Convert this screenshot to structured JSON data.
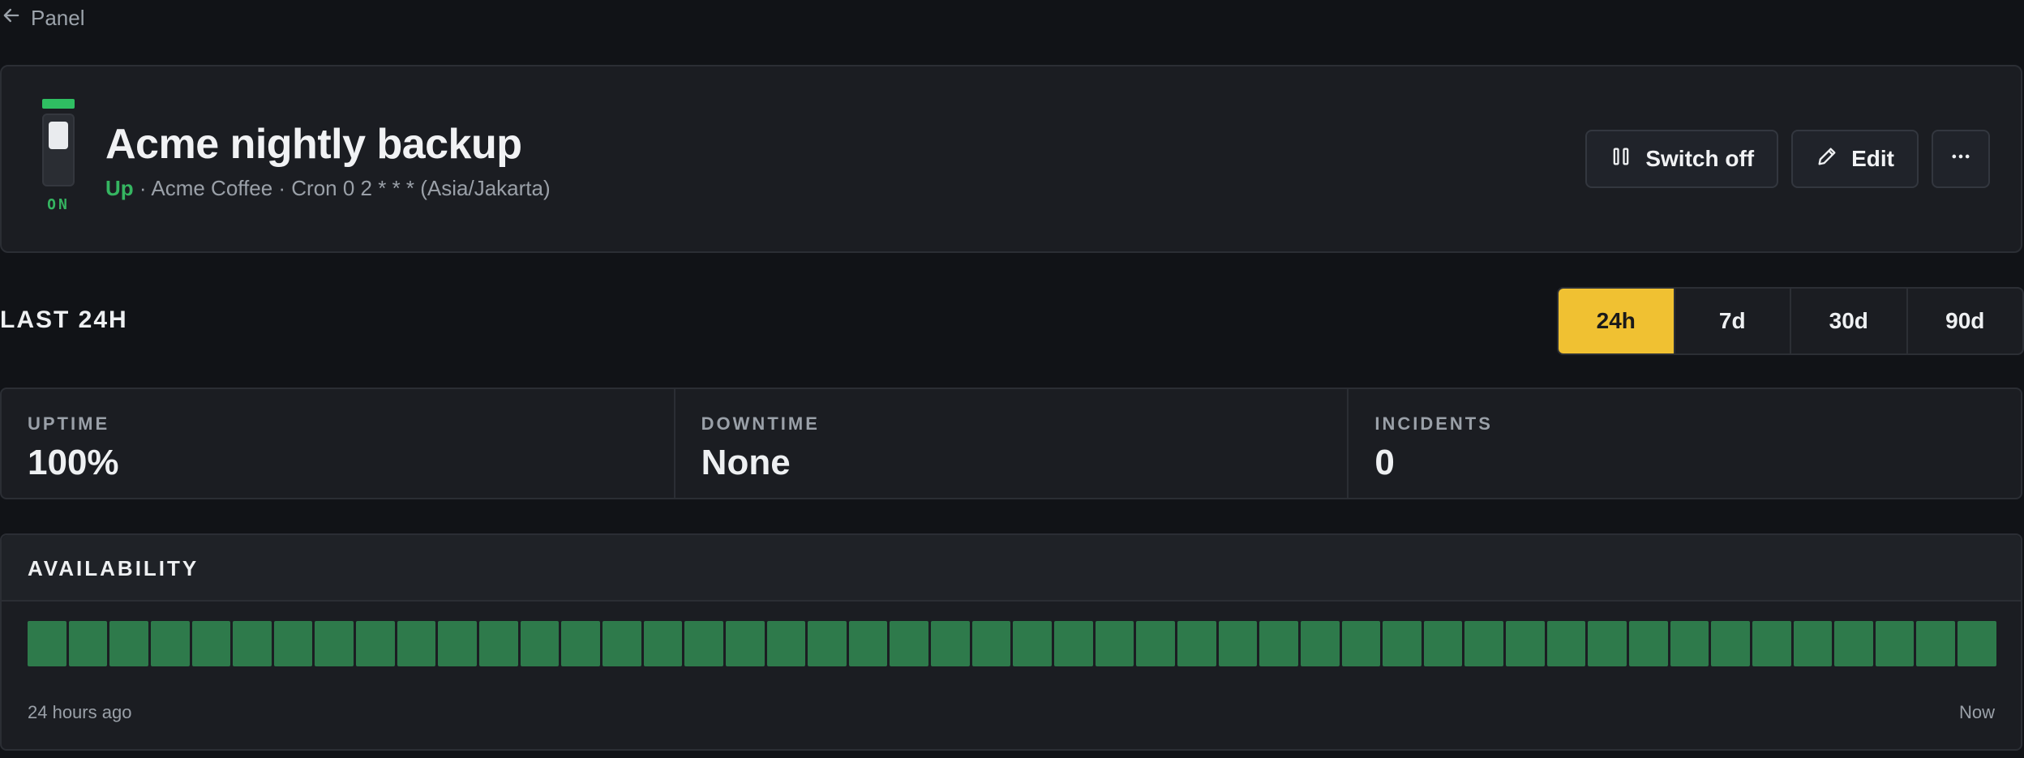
{
  "nav": {
    "back_label": "Panel"
  },
  "monitor": {
    "title": "Acme nightly backup",
    "toggle_state": "ON",
    "status": "Up",
    "meta": "· Acme Coffee · Cron 0 2 * * * (Asia/Jakarta)",
    "status_color": "#35b561"
  },
  "actions": {
    "switch_off_label": "Switch off",
    "edit_label": "Edit",
    "more_icon": "ellipsis-icon"
  },
  "range": {
    "label": "LAST 24H",
    "options": [
      "24h",
      "7d",
      "30d",
      "90d"
    ],
    "selected": "24h",
    "accent_color": "#f0c132"
  },
  "stats": [
    {
      "label": "UPTIME",
      "value": "100%"
    },
    {
      "label": "DOWNTIME",
      "value": "None"
    },
    {
      "label": "INCIDENTS",
      "value": "0"
    }
  ],
  "availability": {
    "title": "AVAILABILITY",
    "bar_count": 48,
    "bar_status": "up",
    "bar_color": "#2e7a4b",
    "start_label": "24 hours ago",
    "end_label": "Now"
  }
}
